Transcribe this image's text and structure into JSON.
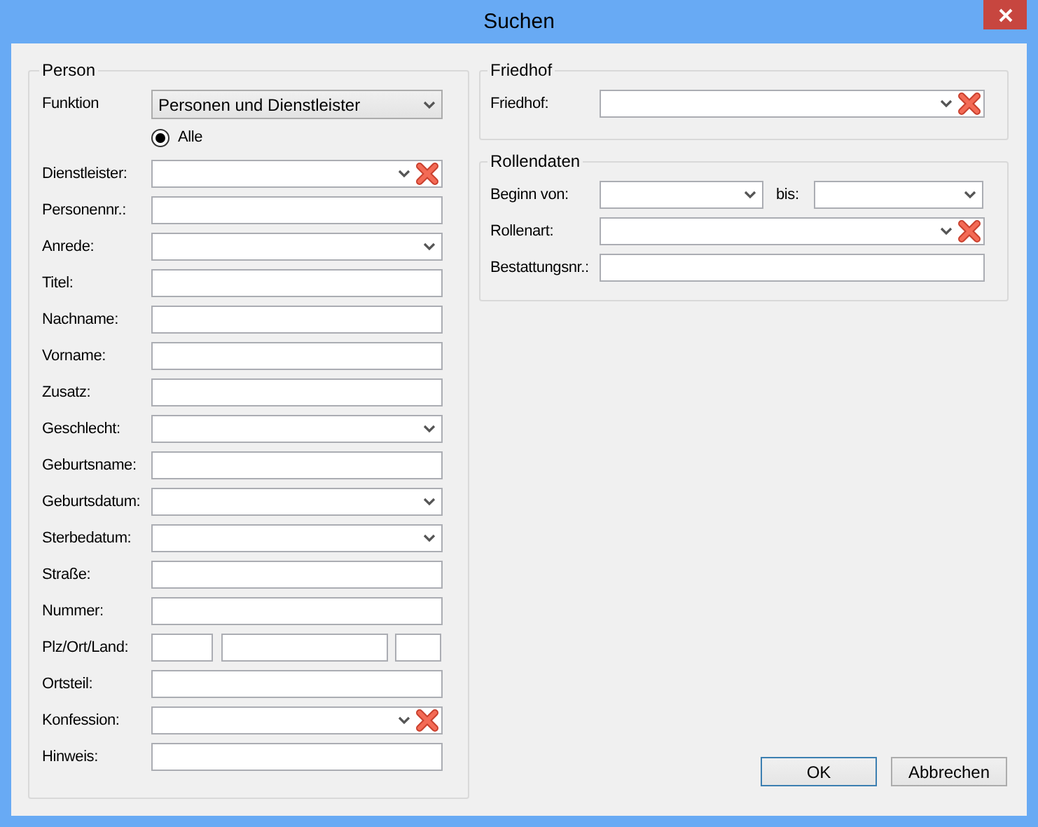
{
  "window": {
    "title": "Suchen"
  },
  "person": {
    "title": "Person",
    "funktion": {
      "label": "Funktion",
      "value": "Personen und Dienstleister"
    },
    "radio": {
      "label": "Alle",
      "checked": true
    },
    "fields": [
      {
        "kind": "combo_clear",
        "label": "Dienstleister:"
      },
      {
        "kind": "text",
        "label": "Personennr.:"
      },
      {
        "kind": "combo",
        "label": "Anrede:"
      },
      {
        "kind": "text",
        "label": "Titel:"
      },
      {
        "kind": "text",
        "label": "Nachname:"
      },
      {
        "kind": "text",
        "label": "Vorname:"
      },
      {
        "kind": "text",
        "label": "Zusatz:"
      },
      {
        "kind": "combo",
        "label": "Geschlecht:"
      },
      {
        "kind": "text",
        "label": "Geburtsname:"
      },
      {
        "kind": "combo",
        "label": "Geburtsdatum:"
      },
      {
        "kind": "combo",
        "label": "Sterbedatum:"
      },
      {
        "kind": "text",
        "label": "Straße:"
      },
      {
        "kind": "text",
        "label": "Nummer:"
      },
      {
        "kind": "triple",
        "label": "Plz/Ort/Land:"
      },
      {
        "kind": "text",
        "label": "Ortsteil:"
      },
      {
        "kind": "combo_clear",
        "label": "Konfession:"
      },
      {
        "kind": "text",
        "label": "Hinweis:"
      }
    ]
  },
  "friedhof": {
    "title": "Friedhof",
    "fields": [
      {
        "kind": "combo_clear",
        "label": "Friedhof:"
      }
    ]
  },
  "rollendaten": {
    "title": "Rollendaten",
    "fields": [
      {
        "kind": "range",
        "label": "Beginn von:",
        "to_label": "bis:"
      },
      {
        "kind": "combo_clear",
        "label": "Rollenart:"
      },
      {
        "kind": "text",
        "label": "Bestattungsnr.:"
      }
    ]
  },
  "buttons": [
    {
      "label": "OK",
      "default": true
    },
    {
      "label": "Abbrechen",
      "default": false
    }
  ]
}
